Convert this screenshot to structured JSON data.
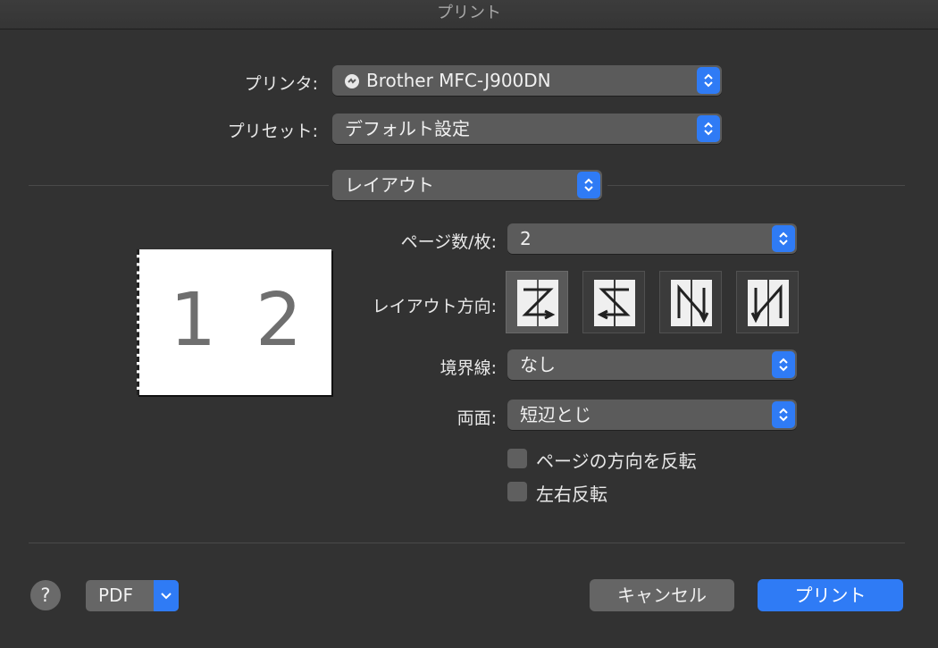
{
  "window": {
    "title": "プリント"
  },
  "printer": {
    "label": "プリンタ:",
    "value": "Brother MFC-J900DN"
  },
  "preset": {
    "label": "プリセット:",
    "value": "デフォルト設定"
  },
  "section": {
    "value": "レイアウト"
  },
  "preview": {
    "page1": "1",
    "page2": "2"
  },
  "pages_per_sheet": {
    "label": "ページ数/枚:",
    "value": "2"
  },
  "layout_direction": {
    "label": "レイアウト方向:",
    "options": [
      "z-order-icon",
      "reverse-z-order-icon",
      "n-order-icon",
      "reverse-n-order-icon"
    ],
    "selected_index": 0
  },
  "border": {
    "label": "境界線:",
    "value": "なし"
  },
  "two_sided": {
    "label": "両面:",
    "value": "短辺とじ"
  },
  "checkboxes": {
    "reverse_orientation": {
      "label": "ページの方向を反転",
      "checked": false
    },
    "flip_horizontal": {
      "label": "左右反転",
      "checked": false
    }
  },
  "footer": {
    "help": "?",
    "pdf": "PDF",
    "cancel": "キャンセル",
    "print": "プリント"
  },
  "colors": {
    "accent": "#2f7bf5",
    "background": "#323232",
    "popup": "#5b5b5b"
  }
}
